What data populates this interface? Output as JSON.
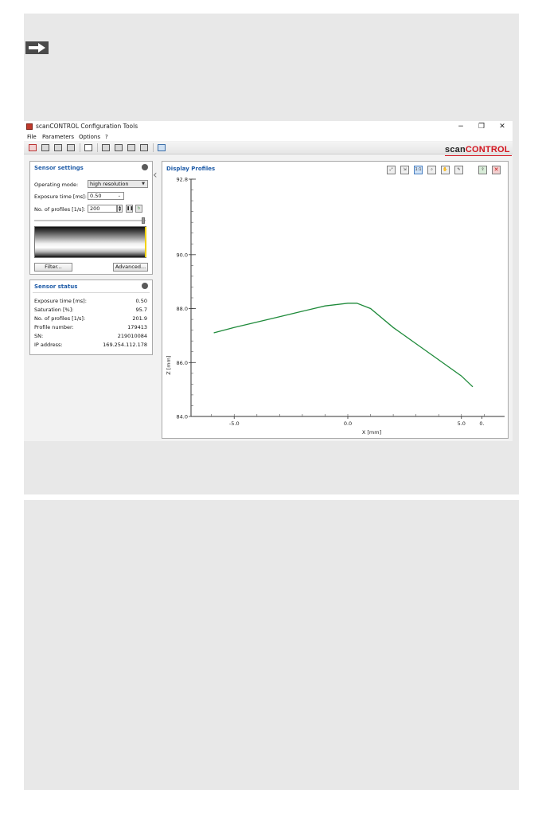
{
  "window": {
    "title": "scanCONTROL Configuration Tools",
    "controls": {
      "minimize": "−",
      "maximize": "❐",
      "close": "✕"
    }
  },
  "menu": [
    "File",
    "Parameters",
    "Options",
    "?"
  ],
  "brand": {
    "part1": "scan",
    "part2": "CONTROL",
    "accent_color": "#d2141e"
  },
  "sensor_settings": {
    "title": "Sensor settings",
    "operating_mode_label": "Operating mode:",
    "operating_mode_value": "high resolution",
    "exposure_time_label": "Exposure time [ms]:",
    "exposure_time_value": "0.50",
    "profiles_label": "No. of profiles [1/s]:",
    "profiles_value": "200",
    "filter_button": "Filter...",
    "advanced_button": "Advanced..."
  },
  "sensor_status": {
    "title": "Sensor status",
    "rows": [
      {
        "label": "Exposure time [ms]:",
        "value": "0.50"
      },
      {
        "label": "Saturation [%]:",
        "value": "95.7"
      },
      {
        "label": "No. of profiles [1/s]:",
        "value": "201.9"
      },
      {
        "label": "Profile number:",
        "value": "179413"
      },
      {
        "label": "SN:",
        "value": "219010084"
      },
      {
        "label": "IP address:",
        "value": "169.254.112.178"
      }
    ]
  },
  "display_profiles": {
    "title": "Display Profiles",
    "tools": [
      "fit-icon",
      "autoscale-icon",
      "1:1",
      "zoom-icon",
      "pan-icon",
      "picker-icon",
      "export-icon",
      "clear-icon"
    ],
    "one_to_one_label": "1:1"
  },
  "chart_data": {
    "type": "line",
    "xlabel": "X [mm]",
    "ylabel": "Z [mm]",
    "xlim": [
      -6.9,
      6.9
    ],
    "ylim": [
      84.0,
      92.8
    ],
    "x_ticks": [
      {
        "value": -5.0,
        "label": "-5.0"
      },
      {
        "value": 0.0,
        "label": "0.0"
      },
      {
        "value": 5.0,
        "label": "5.0"
      },
      {
        "value": 5.9,
        "label": "0."
      }
    ],
    "y_ticks": [
      {
        "value": 92.8,
        "label": "92.8"
      },
      {
        "value": 90.0,
        "label": "90.0"
      },
      {
        "value": 88.0,
        "label": "88.0"
      },
      {
        "value": 86.0,
        "label": "86.0"
      },
      {
        "value": 84.0,
        "label": "84.0"
      }
    ],
    "color": "#1e8a3a",
    "series": [
      {
        "x": [
          -5.9,
          -5.0,
          -4.0,
          -3.0,
          -2.0,
          -1.0,
          0.0,
          0.4,
          1.0,
          2.0,
          3.0,
          4.0,
          5.0,
          5.5
        ],
        "values": [
          87.1,
          87.3,
          87.5,
          87.7,
          87.9,
          88.1,
          88.2,
          88.2,
          88.0,
          87.3,
          86.7,
          86.1,
          85.5,
          85.1
        ]
      }
    ],
    "grid": false
  },
  "colors": {
    "heading_blue": "#1f5ca8",
    "panel_gray": "#e8e8e8"
  }
}
